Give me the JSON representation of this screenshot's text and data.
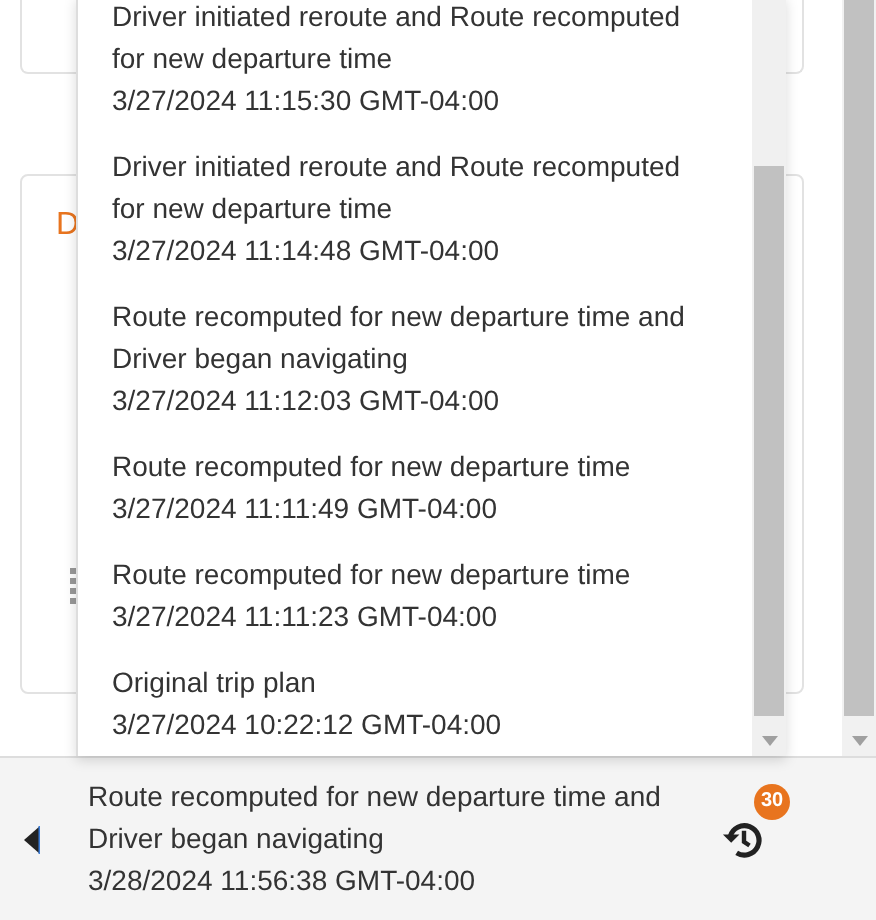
{
  "background_card": {
    "label": "D"
  },
  "history_list": {
    "items": [
      {
        "title": "Driver initiated reroute and Route recomputed for new departure time",
        "time": "3/27/2024 11:15:30 GMT-04:00"
      },
      {
        "title": "Driver initiated reroute and Route recomputed for new departure time",
        "time": "3/27/2024 11:14:48 GMT-04:00"
      },
      {
        "title": "Route recomputed for new departure time and Driver began navigating",
        "time": "3/27/2024 11:12:03 GMT-04:00"
      },
      {
        "title": "Route recomputed for new departure time",
        "time": "3/27/2024 11:11:49 GMT-04:00"
      },
      {
        "title": "Route recomputed for new departure time",
        "time": "3/27/2024 11:11:23 GMT-04:00"
      },
      {
        "title": "Original trip plan",
        "time": "3/27/2024 10:22:12 GMT-04:00"
      }
    ]
  },
  "footer": {
    "title": "Route recomputed for new departure time and Driver began navigating",
    "time": "3/28/2024 11:56:38 GMT-04:00",
    "badge": "30"
  }
}
